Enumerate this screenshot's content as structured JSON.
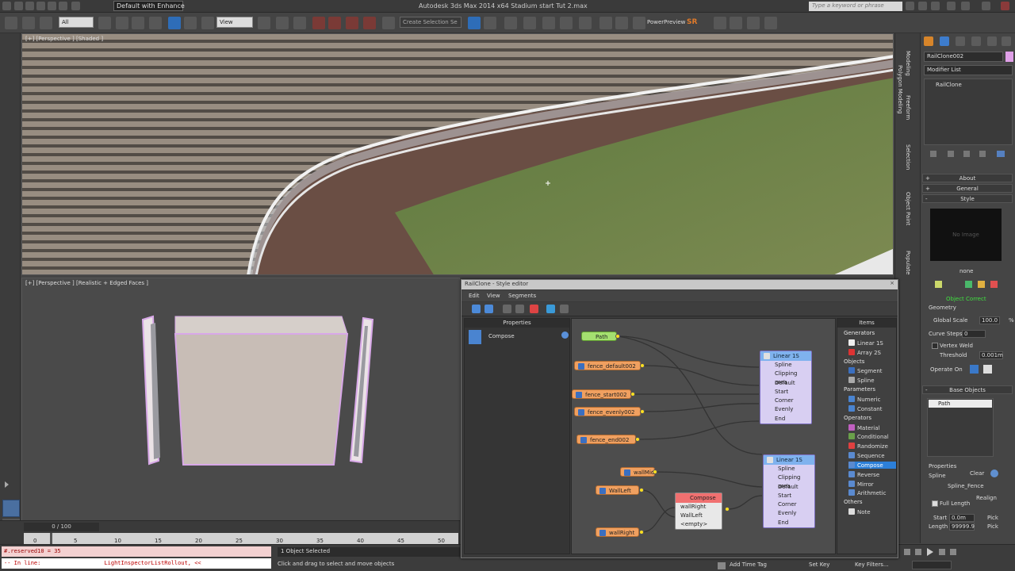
{
  "titlebar": {
    "workspace": "Default with Enhance",
    "app_title": "Autodesk 3ds Max  2014 x64     Stadium start Tut 2.max",
    "search_placeholder": "Type a keyword or phrase"
  },
  "toolbar": {
    "filter_value": "All",
    "ref_coord": "View",
    "selection_set_placeholder": "Create Selection Se",
    "powerpreview_label": "PowerPreview",
    "sr_label": "SR"
  },
  "viewport_top": {
    "label": "[+] [Perspective ] [Shaded ]"
  },
  "viewport_bottom": {
    "label": "[+] [Perspective ] [Realistic + Edged Faces ]"
  },
  "timeline": {
    "frame_display": "0 / 100",
    "ticks": [
      "0",
      "5",
      "10",
      "15",
      "20",
      "25",
      "30",
      "35",
      "40",
      "45",
      "50"
    ]
  },
  "statusbar": {
    "script_line1": "#.reserved10 = 35",
    "script_line2": "-- In line:                   LightInspectorListRollout, <<",
    "selection": "1 Object Selected",
    "hint": "Click and drag to select and move objects",
    "add_time_tag": "Add Time Tag",
    "set_key": "Set Key",
    "key_filters": "Key Filters..."
  },
  "ribbon_tabs": [
    "Modeling",
    "Polygon Modeling",
    "Freeform",
    "Selection",
    "Object Paint",
    "Populate"
  ],
  "command_panel": {
    "object_name": "RailClone002",
    "modifier_list": "Modifier List",
    "stack_item": "RailClone",
    "rollouts": {
      "about": "About",
      "general": "General",
      "style": "Style"
    },
    "no_image": "No Image",
    "style_name": "none",
    "object_status": "Object Correct",
    "geometry_label": "Geometry",
    "global_scale_label": "Global Scale",
    "global_scale_value": "100.0",
    "global_scale_unit": "%",
    "curve_steps_label": "Curve Steps",
    "curve_steps_value": "0",
    "vertex_weld_label": "Vertex Weld",
    "threshold_label": "Threshold",
    "threshold_value": "0.001m",
    "operate_on_label": "Operate On",
    "base_objects_label": "Base Objects",
    "base_object_item": "Path",
    "properties_label": "Properties",
    "spline_label": "Spline",
    "clear_label": "Clear",
    "spline_value": "Spline_Fence",
    "realign_label": "Realign",
    "full_length_label": "Full Length",
    "start_label": "Start",
    "start_value": "0.0m",
    "length_label": "Length",
    "length_value": "99999.9",
    "pick_label": "Pick"
  },
  "style_editor": {
    "title": "RailClone - Style editor",
    "close": "×",
    "menu": [
      "Edit",
      "View",
      "Segments"
    ],
    "properties_header": "Properties",
    "properties_item": "Compose",
    "items_header": "Items",
    "items": [
      {
        "label": "Generators",
        "group": true
      },
      {
        "label": "Linear 1S",
        "group": false
      },
      {
        "label": "Array 2S",
        "group": false
      },
      {
        "label": "Objects",
        "group": true
      },
      {
        "label": "Segment",
        "group": false
      },
      {
        "label": "Spline",
        "group": false
      },
      {
        "label": "Parameters",
        "group": true
      },
      {
        "label": "Numeric",
        "group": false
      },
      {
        "label": "Constant",
        "group": false
      },
      {
        "label": "Operators",
        "group": true
      },
      {
        "label": "Material",
        "group": false
      },
      {
        "label": "Conditional",
        "group": false
      },
      {
        "label": "Randomize",
        "group": false
      },
      {
        "label": "Sequence",
        "group": false
      },
      {
        "label": "Compose",
        "group": false,
        "selected": true
      },
      {
        "label": "Reverse",
        "group": false
      },
      {
        "label": "Mirror",
        "group": false
      },
      {
        "label": "Arithmetic",
        "group": false
      },
      {
        "label": "Others",
        "group": true
      },
      {
        "label": "Note",
        "group": false
      }
    ],
    "nodes": {
      "path": "Path",
      "fence_default": "fence_default002",
      "fence_start": "fence_start002",
      "fence_evenly": "fence_evenly002",
      "fence_end": "fence_end002",
      "wall_mid": "wallMid",
      "wall_left": "WallLeft",
      "wall_right": "wallRight",
      "compose_title": "Compose",
      "compose_rows": [
        "wallRight",
        "WallLeft",
        "<empty>"
      ],
      "linear_a_title": "Linear 1S",
      "linear_b_title": "Linear 1S",
      "linear_rows": [
        "Spline",
        "Clipping area",
        "Default",
        "Start",
        "Corner",
        "Evenly",
        "End"
      ]
    }
  }
}
